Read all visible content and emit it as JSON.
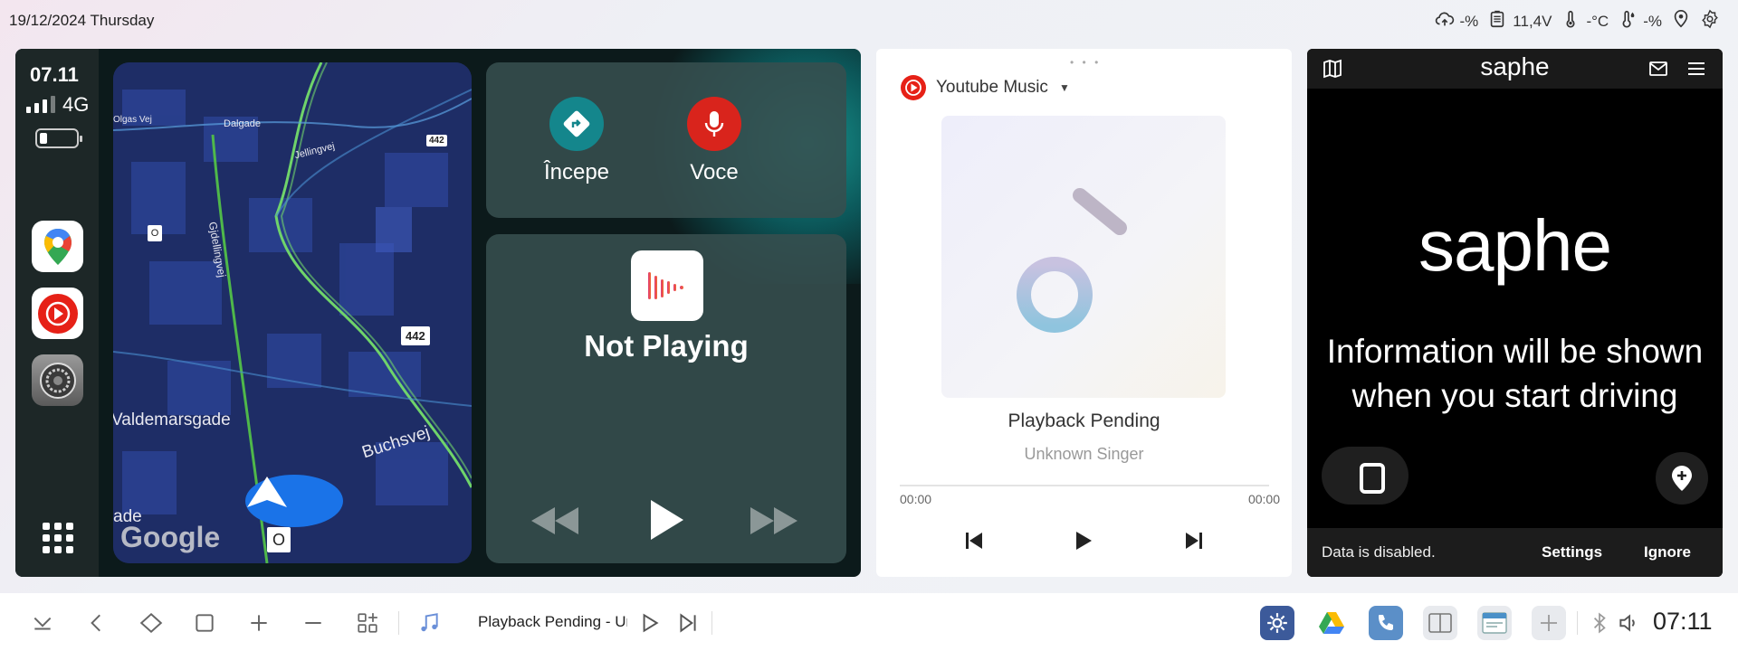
{
  "status_bar": {
    "date": "19/12/2024 Thursday",
    "cloud_value": "-%",
    "battery_voltage": "11,4V",
    "temperature": "-°C",
    "humidity": "-%"
  },
  "carplay": {
    "time": "07.11",
    "network": "4G",
    "apps": [
      "google-maps",
      "youtube-music",
      "settings"
    ],
    "map": {
      "streets": [
        "Dalgade",
        "Jellingvej",
        "Gjdellingvej",
        "Valdemarsgade",
        "Buchsvej",
        "Olgas Vej",
        "ade"
      ],
      "road_numbers": [
        "442",
        "442"
      ],
      "markers": [
        "O",
        "O"
      ],
      "brand": "Google"
    },
    "actions": {
      "start_label": "Începe",
      "voice_label": "Voce"
    },
    "now_playing": {
      "title": "Not Playing"
    }
  },
  "youtube_music": {
    "source": "Youtube Music",
    "track": "Playback Pending",
    "artist": "Unknown Singer",
    "time_current": "00:00",
    "time_total": "00:00",
    "progress": 0
  },
  "saphe": {
    "header_logo": "saphe",
    "logo": "saphe",
    "message_line1": "Information will be shown",
    "message_line2": "when you start driving",
    "data_status": "Data is disabled.",
    "settings_label": "Settings",
    "ignore_label": "Ignore"
  },
  "dock": {
    "song": "Playback Pending - Unknown Singer",
    "clock": "07:11"
  },
  "colors": {
    "accent_blue": "#1a73e8",
    "youtube_red": "#e62117",
    "nav_teal": "#14868c",
    "voice_red": "#d9241c"
  }
}
